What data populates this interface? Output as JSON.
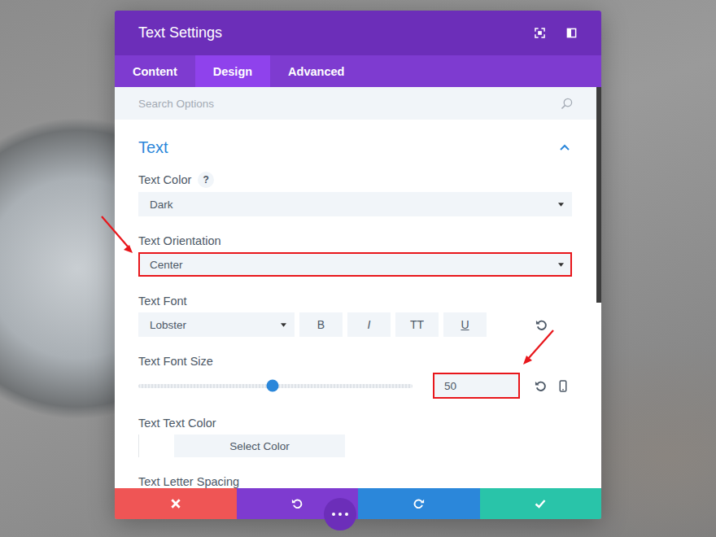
{
  "window": {
    "title": "Text Settings"
  },
  "tabs": [
    {
      "label": "Content",
      "selected": false
    },
    {
      "label": "Design",
      "selected": true
    },
    {
      "label": "Advanced",
      "selected": false
    }
  ],
  "search": {
    "placeholder": "Search Options"
  },
  "section": {
    "title": "Text",
    "expanded": true
  },
  "fields": [
    {
      "kind": "select",
      "label": "Text Color",
      "help": "?",
      "value": "Dark",
      "highlighted": false
    },
    {
      "kind": "select",
      "label": "Text Orientation",
      "help": "",
      "value": "Center",
      "highlighted": true
    },
    {
      "kind": "font",
      "label": "Text Font",
      "value": "Lobster",
      "styles": [
        "B",
        "I",
        "TT",
        "U"
      ],
      "highlighted": false
    },
    {
      "kind": "slider",
      "label": "Text Font Size",
      "level": 0.49,
      "value": "50",
      "highlighted": true
    },
    {
      "kind": "color",
      "label": "Text Text Color",
      "button": "Select Color",
      "highlighted": false
    },
    {
      "kind": "label",
      "label": "Text Letter Spacing",
      "highlighted": false
    }
  ]
}
